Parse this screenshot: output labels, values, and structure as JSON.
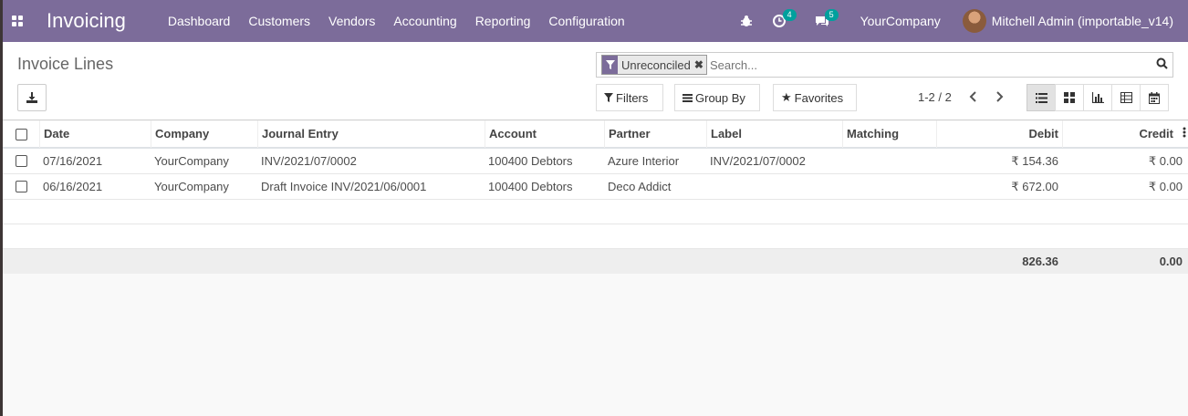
{
  "navbar": {
    "app_title": "Invoicing",
    "menu": [
      "Dashboard",
      "Customers",
      "Vendors",
      "Accounting",
      "Reporting",
      "Configuration"
    ],
    "activity_count": "4",
    "message_count": "5",
    "company": "YourCompany",
    "user": "Mitchell Admin (importable_v14)"
  },
  "control": {
    "title": "Invoice Lines",
    "facet_label": "Unreconciled",
    "facet_remove": "✖",
    "search_placeholder": "Search...",
    "filters_label": "Filters",
    "groupby_label": "Group By",
    "favorites_label": "Favorites",
    "pager": "1-2 / 2"
  },
  "table": {
    "columns": [
      "Date",
      "Company",
      "Journal Entry",
      "Account",
      "Partner",
      "Label",
      "Matching",
      "Debit",
      "Credit"
    ],
    "rows": [
      {
        "date": "07/16/2021",
        "company": "YourCompany",
        "journal_entry": "INV/2021/07/0002",
        "account": "100400 Debtors",
        "partner": "Azure Interior",
        "label": "INV/2021/07/0002",
        "matching": "",
        "debit": "₹ 154.36",
        "credit": "₹ 0.00"
      },
      {
        "date": "06/16/2021",
        "company": "YourCompany",
        "journal_entry": "Draft Invoice INV/2021/06/0001",
        "account": "100400 Debtors",
        "partner": "Deco Addict",
        "label": "",
        "matching": "",
        "debit": "₹ 672.00",
        "credit": "₹ 0.00"
      }
    ],
    "totals": {
      "debit": "826.36",
      "credit": "0.00"
    }
  },
  "colors": {
    "navbar": "#7c6c9a",
    "badge": "#00a09d"
  }
}
